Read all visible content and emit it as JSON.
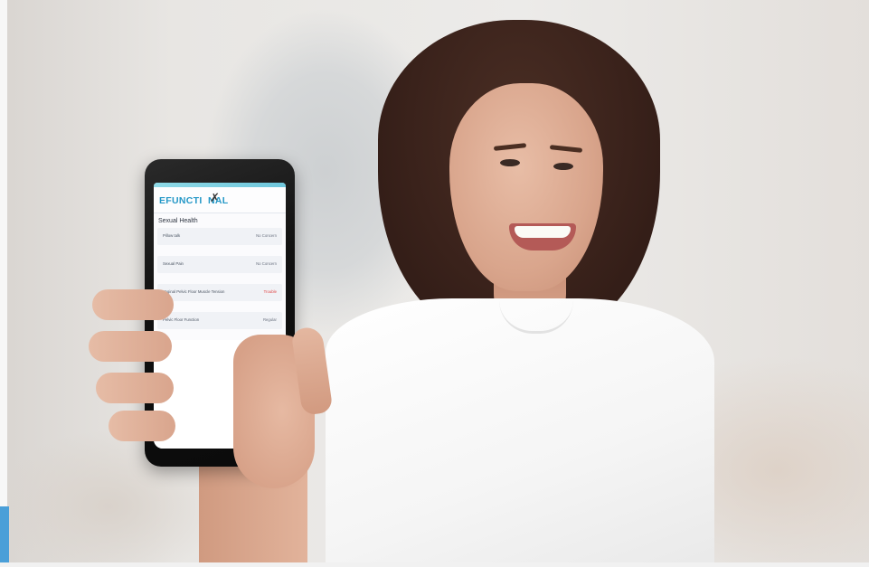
{
  "app": {
    "logo_text": "EFUNCTI  NAL",
    "section_title": "Sexual Health",
    "items": [
      {
        "label": "Pillow talk",
        "status": "No Concern",
        "status_color": "#6b7280"
      },
      {
        "label": "Sexual Pain",
        "status": "No Concern",
        "status_color": "#6b7280"
      },
      {
        "label": "Vaginal Pelvic Floor Muscle Tension",
        "status": "Trouble",
        "status_color": "#e04848"
      },
      {
        "label": "Pelvic Floor Function",
        "status": "Regular",
        "status_color": "#6b7280"
      }
    ]
  },
  "colors": {
    "brand": "#2598c7",
    "accent_strip": "#8ed9e6",
    "corner_accent": "#4a9fd8"
  },
  "icons": [
    "logo-figure-icon"
  ]
}
